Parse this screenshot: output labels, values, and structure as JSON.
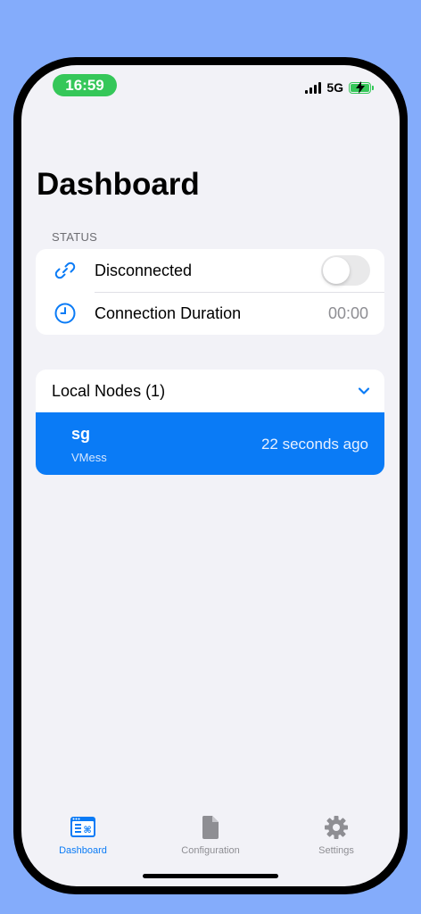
{
  "status_bar": {
    "time": "16:59",
    "network": "5G"
  },
  "page": {
    "title": "Dashboard"
  },
  "status_section": {
    "header": "STATUS",
    "connection_label": "Disconnected",
    "connection_enabled": false,
    "duration_label": "Connection Duration",
    "duration_value": "00:00"
  },
  "local_nodes": {
    "header": "Local Nodes (1)",
    "expanded": true,
    "nodes": [
      {
        "name": "sg",
        "protocol": "VMess",
        "last_seen": "22 seconds ago",
        "selected": true
      }
    ]
  },
  "tab_bar": {
    "tabs": [
      {
        "label": "Dashboard",
        "icon": "dashboard-icon",
        "active": true
      },
      {
        "label": "Configuration",
        "icon": "document-icon",
        "active": false
      },
      {
        "label": "Settings",
        "icon": "gear-icon",
        "active": false
      }
    ]
  },
  "colors": {
    "accent": "#0a7bf6",
    "time_pill": "#35c759",
    "background": "#f2f2f7",
    "outer_background": "#84acfb"
  }
}
